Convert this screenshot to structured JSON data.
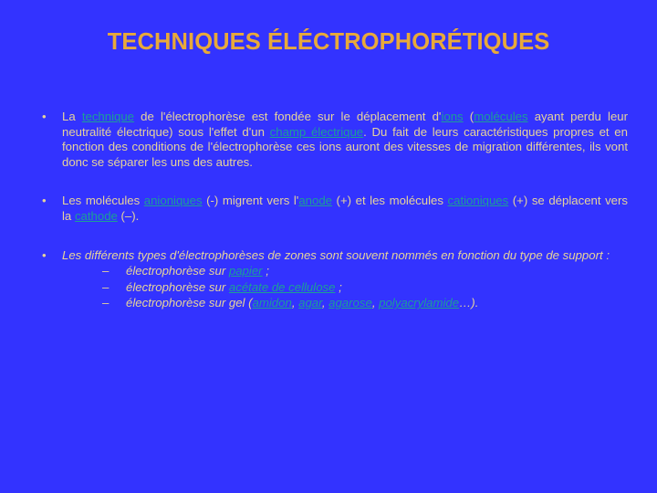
{
  "slide": {
    "title": "TECHNIQUES ÉLÉCTROPHORÉTIQUES",
    "background_color": "#3333ff",
    "title_color": "#e8a93a",
    "body_color": "#e6d39a",
    "link_color": "#1c9f96",
    "bullet_marker": "•",
    "sub_bullet_marker": "–"
  },
  "bullets": [
    {
      "marker": "•",
      "style": "normal",
      "runs": [
        {
          "text": "La ",
          "link": false
        },
        {
          "text": "technique",
          "link": true
        },
        {
          "text": " de l'électrophorèse est fondée sur le déplacement d'",
          "link": false
        },
        {
          "text": "ions",
          "link": true
        },
        {
          "text": " (",
          "link": false
        },
        {
          "text": "molécules",
          "link": true
        },
        {
          "text": " ayant perdu leur neutralité électrique) sous l'effet d'un ",
          "link": false
        },
        {
          "text": "champ électrique",
          "link": true
        },
        {
          "text": ". Du fait de leurs caractéristiques propres et en fonction des conditions de l'électrophorèse ces ions auront des vitesses de migration différentes, ils vont donc se séparer les uns des autres.",
          "link": false
        }
      ]
    },
    {
      "marker": "•",
      "style": "normal",
      "runs": [
        {
          "text": "Les molécules ",
          "link": false
        },
        {
          "text": "anioniques",
          "link": true
        },
        {
          "text": " (-) migrent vers l'",
          "link": false
        },
        {
          "text": "anode",
          "link": true
        },
        {
          "text": " (+) et les molécules ",
          "link": false
        },
        {
          "text": "cationiques",
          "link": true
        },
        {
          "text": " (+) se déplacent vers la ",
          "link": false
        },
        {
          "text": "cathode",
          "link": true
        },
        {
          "text": " (–).",
          "link": false
        }
      ]
    },
    {
      "marker": "•",
      "style": "italic",
      "runs": [
        {
          "text": "Les différents types d'électrophorèses de zones sont souvent nommés en fonction du type de support :",
          "link": false
        }
      ],
      "sub_items": [
        {
          "marker": "–",
          "runs": [
            {
              "text": "électrophorèse sur ",
              "link": false
            },
            {
              "text": "papier",
              "link": true
            },
            {
              "text": " ;",
              "link": false
            }
          ]
        },
        {
          "marker": "–",
          "runs": [
            {
              "text": "électrophorèse sur ",
              "link": false
            },
            {
              "text": "acétate de cellulose",
              "link": true
            },
            {
              "text": " ;",
              "link": false
            }
          ]
        },
        {
          "marker": "–",
          "runs": [
            {
              "text": "électrophorèse sur gel (",
              "link": false
            },
            {
              "text": "amidon",
              "link": true
            },
            {
              "text": ", ",
              "link": false
            },
            {
              "text": "agar",
              "link": true
            },
            {
              "text": ", ",
              "link": false
            },
            {
              "text": "agarose",
              "link": true
            },
            {
              "text": ", ",
              "link": false
            },
            {
              "text": "polyacrylamide",
              "link": true
            },
            {
              "text": "…).",
              "link": false
            }
          ]
        }
      ]
    }
  ]
}
